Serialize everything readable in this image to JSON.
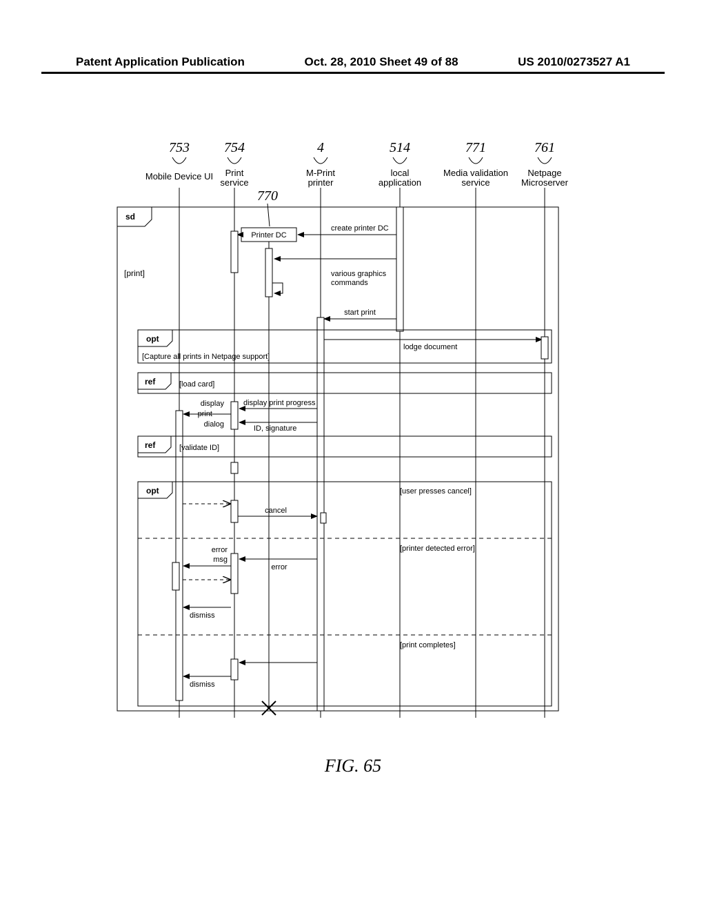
{
  "header": {
    "left": "Patent Application Publication",
    "center": "Oct. 28, 2010  Sheet 49 of 88",
    "right": "US 2010/0273527 A1"
  },
  "caption": "FIG. 65",
  "participants": [
    {
      "ref": "753",
      "line1": "Mobile Device UI",
      "line2": ""
    },
    {
      "ref": "754",
      "line1": "Print",
      "line2": "service"
    },
    {
      "ref": "4",
      "line1": "M-Print",
      "line2": "printer"
    },
    {
      "ref": "514",
      "line1": "local",
      "line2": "application"
    },
    {
      "ref": "771",
      "line1": "Media validation",
      "line2": "service"
    },
    {
      "ref": "761",
      "line1": "Netpage",
      "line2": "Microserver"
    }
  ],
  "extra_refs": {
    "printer_dc": "770"
  },
  "frames": {
    "sd": "sd",
    "sd_guard": "[print]",
    "opt1": "opt",
    "opt1_guard": "[Capture all prints in Netpage support]",
    "ref1": "ref",
    "ref1_label": "[load card]",
    "ref2": "ref",
    "ref2_label": "[validate ID]",
    "opt2": "opt",
    "opt2_guard1": "[user presses cancel]",
    "opt2_guard2": "[printer detected error]",
    "opt2_guard3": "[print completes]"
  },
  "messages": {
    "create_printer_dc": "create printer  DC",
    "printer_dc_return": "Printer DC",
    "graphics_cmds_l1": "various graphics",
    "graphics_cmds_l2": "commands",
    "start_print": "start print",
    "lodge_document": "lodge document",
    "display_print_progress": "display print progress",
    "id_signature": "ID, signature",
    "display_print_dialog_l1": "display",
    "display_print_dialog_l2": "print",
    "display_print_dialog_l3": "dialog",
    "cancel": "cancel",
    "error": "error",
    "error_msg_l1": "error",
    "error_msg_l2": "msg",
    "dismiss": "dismiss"
  }
}
